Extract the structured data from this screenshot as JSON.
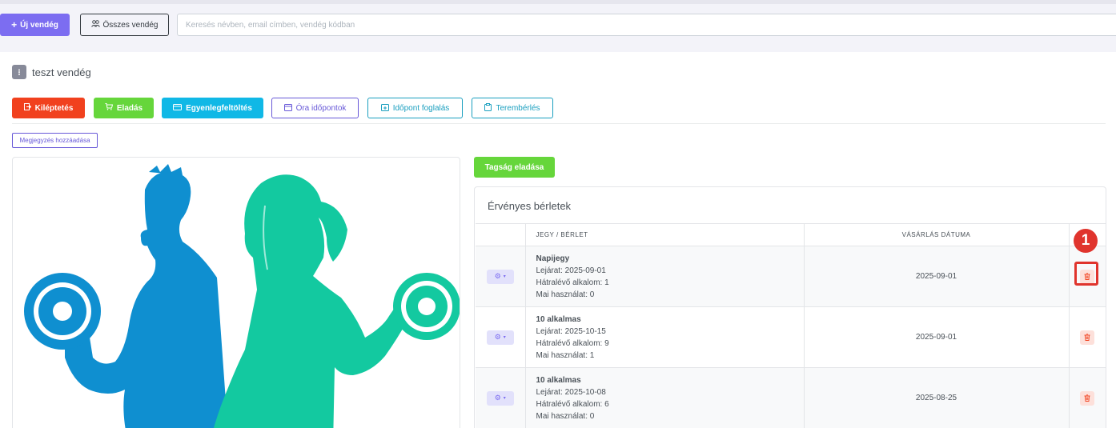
{
  "toolbar": {
    "new_guest_label": "Új vendég",
    "all_guests_label": "Összes vendég",
    "search_placeholder": "Keresés névben, email címben, vendég kódban"
  },
  "guest": {
    "icon_glyph": "⁝",
    "name": "teszt vendég"
  },
  "actions": {
    "checkout": "Kiléptetés",
    "sale": "Eladás",
    "balance_topup": "Egyenlegfeltöltés",
    "class_times": "Óra időpontok",
    "appointment_booking": "Időpont foglalás",
    "room_rental": "Terembérlés",
    "add_note": "Megjegyzés hozzáadása"
  },
  "membership_sale_label": "Tagság eladása",
  "passes": {
    "title": "Érvényes bérletek",
    "columns": [
      "JEGY / BÉRLET",
      "VÁSÁRLÁS DÁTUMA"
    ],
    "rows": [
      {
        "name": "Napijegy",
        "expiry": "Lejárat: 2025-09-01",
        "remaining": "Hátralévő alkalom: 1",
        "today_usage": "Mai használat: 0",
        "purchase_date": "2025-09-01"
      },
      {
        "name": "10 alkalmas",
        "expiry": "Lejárat: 2025-10-15",
        "remaining": "Hátralévő alkalom: 9",
        "today_usage": "Mai használat: 1",
        "purchase_date": "2025-09-01"
      },
      {
        "name": "10 alkalmas",
        "expiry": "Lejárat: 2025-10-08",
        "remaining": "Hátralévő alkalom: 6",
        "today_usage": "Mai használat: 0",
        "purchase_date": "2025-08-25"
      }
    ]
  },
  "annotation_badge": "1",
  "colors": {
    "primary": "#7c6df1",
    "danger": "#f1411e",
    "success": "#66d63b",
    "info": "#10b8e6",
    "man_figure": "#0f8fd0",
    "woman_figure": "#13c9a0",
    "annotation": "#e0342d"
  },
  "icons": {
    "gear": "gear-icon",
    "trash": "trash-icon",
    "plus": "plus-icon",
    "users": "users-icon"
  }
}
